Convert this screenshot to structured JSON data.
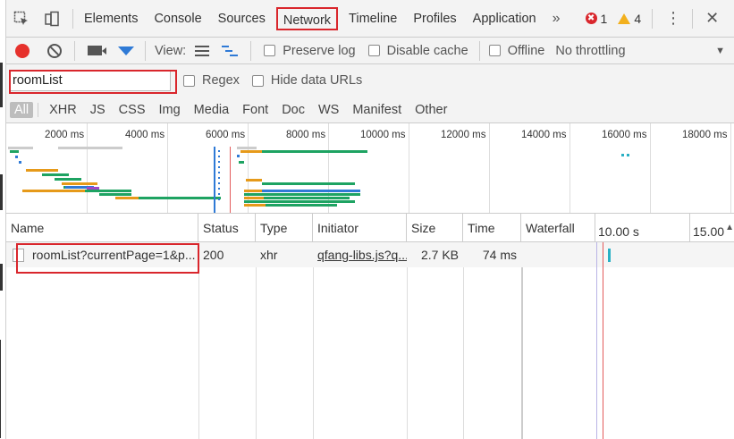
{
  "tabbar": {
    "tabs": [
      "Elements",
      "Console",
      "Sources",
      "Network",
      "Timeline",
      "Profiles",
      "Application"
    ],
    "active_tab": "Network",
    "more": "»",
    "error_count": "1",
    "warning_count": "4",
    "error_glyph": "✖",
    "kebab": "⋮",
    "close": "✕"
  },
  "toolbar": {
    "view_label": "View:",
    "preserve_log": "Preserve log",
    "disable_cache": "Disable cache",
    "offline": "Offline",
    "throttling": "No throttling",
    "caret": "▼"
  },
  "filter": {
    "value": "roomList",
    "regex": "Regex",
    "hide_data_urls": "Hide data URLs"
  },
  "types": [
    "All",
    "XHR",
    "JS",
    "CSS",
    "Img",
    "Media",
    "Font",
    "Doc",
    "WS",
    "Manifest",
    "Other"
  ],
  "overview": {
    "ticks": [
      "2000 ms",
      "4000 ms",
      "6000 ms",
      "8000 ms",
      "10000 ms",
      "12000 ms",
      "14000 ms",
      "16000 ms",
      "18000 ms"
    ]
  },
  "table": {
    "headers": {
      "name": "Name",
      "status": "Status",
      "type": "Type",
      "initiator": "Initiator",
      "size": "Size",
      "time": "Time",
      "waterfall": "Waterfall",
      "t10": "10.00 s",
      "t15": "15.00"
    },
    "rows": [
      {
        "name": "roomList?currentPage=1&p...",
        "status": "200",
        "type": "xhr",
        "initiator": "qfang-libs.js?q...",
        "size": "2.7 KB",
        "time": "74 ms"
      }
    ]
  },
  "colors": {
    "accent_red": "#d9262c",
    "blue": "#2f7ad6",
    "record": "#e6312c"
  }
}
